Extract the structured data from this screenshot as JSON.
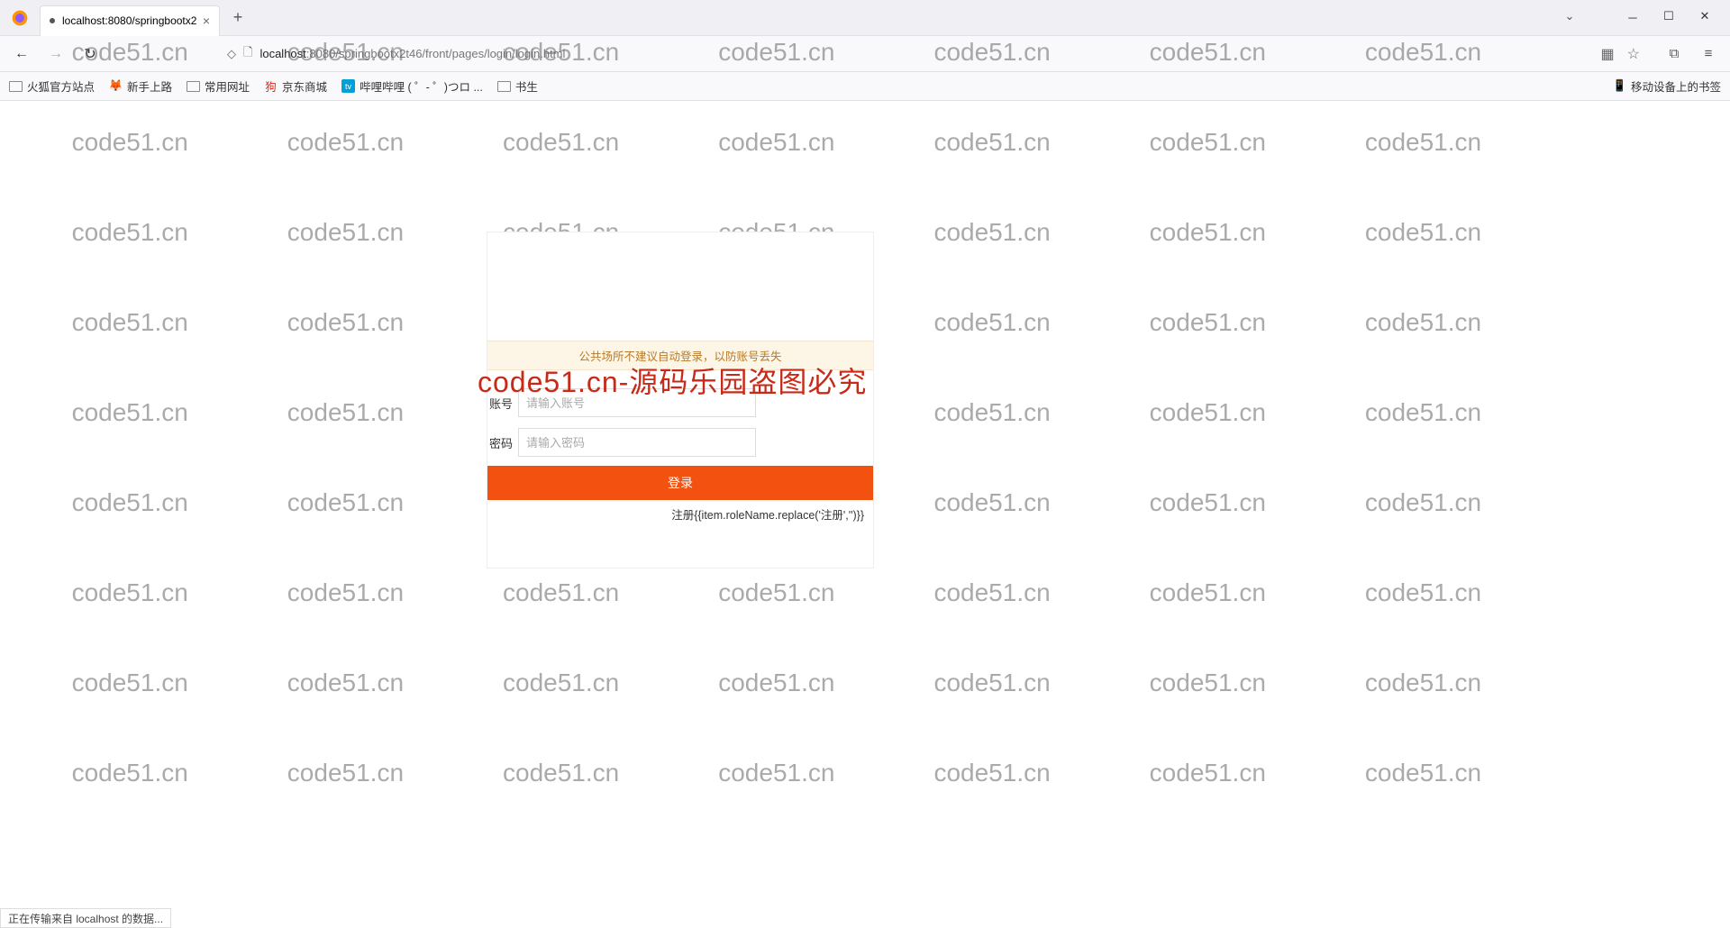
{
  "browser": {
    "tab_title": "localhost:8080/springbootx2",
    "url_host": "localhost",
    "url_port_path": ":8080/springbootx2t46/front/pages/login/login.html",
    "bookmarks": [
      "火狐官方站点",
      "新手上路",
      "常用网址",
      "京东商城",
      "哔哩哔哩 ( ゜- ゜)つロ ...",
      "书生"
    ],
    "bookmark_right": "移动设备上的书签",
    "status": "正在传输来自 localhost 的数据..."
  },
  "login": {
    "warning": "公共场所不建议自动登录，以防账号丢失",
    "username_label": "账号",
    "username_placeholder": "请输入账号",
    "password_label": "密码",
    "password_placeholder": "请输入密码",
    "login_button": "登录",
    "register_text": "注册{{item.roleName.replace('注册','')}}"
  },
  "watermark": {
    "text": "code51.cn",
    "overlay": "code51.cn-源码乐园盗图必究"
  }
}
